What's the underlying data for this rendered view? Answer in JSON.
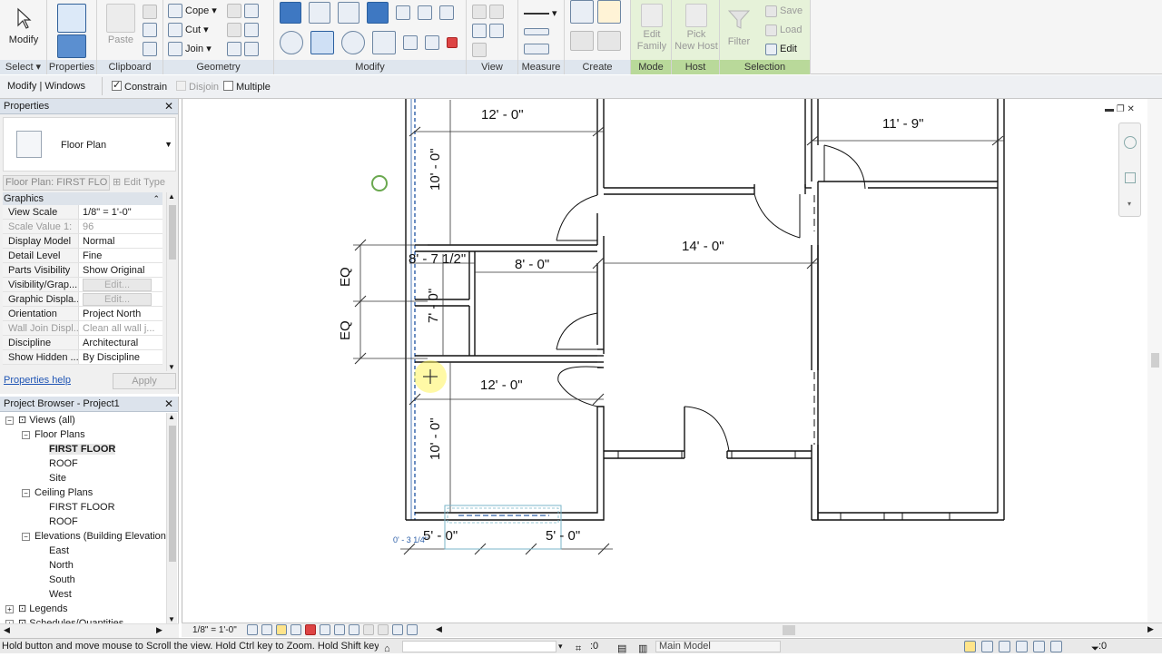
{
  "ribbon": {
    "modify_label": "Modify",
    "paste_label": "Paste",
    "cope_label": "Cope",
    "cut_label": "Cut",
    "join_label": "Join",
    "edit_family_line1": "Edit",
    "edit_family_line2": "Family",
    "pick_host_line1": "Pick",
    "pick_host_line2": "New Host",
    "filter_label": "Filter",
    "save_label": "Save",
    "load_label": "Load",
    "edit_label": "Edit",
    "panels": {
      "select": "Select",
      "properties": "Properties",
      "clipboard": "Clipboard",
      "geometry": "Geometry",
      "modify": "Modify",
      "view": "View",
      "measure": "Measure",
      "create": "Create",
      "mode": "Mode",
      "host": "Host",
      "selection": "Selection"
    }
  },
  "options_bar": {
    "context": "Modify | Windows",
    "constrain": "Constrain",
    "disjoin": "Disjoin",
    "multiple": "Multiple"
  },
  "properties": {
    "title": "Properties",
    "type_name": "Floor Plan",
    "instance_selector": "Floor Plan: FIRST FLO",
    "edit_type": "Edit Type",
    "group": "Graphics",
    "rows": [
      {
        "key": "View Scale",
        "value": "1/8\" = 1'-0\"",
        "disabled": false
      },
      {
        "key": "Scale Value    1:",
        "value": "96",
        "disabled": true
      },
      {
        "key": "Display Model",
        "value": "Normal",
        "disabled": false
      },
      {
        "key": "Detail Level",
        "value": "Fine",
        "disabled": false
      },
      {
        "key": "Parts Visibility",
        "value": "Show Original",
        "disabled": false
      },
      {
        "key": "Visibility/Grap...",
        "value": "Edit...",
        "disabled": false
      },
      {
        "key": "Graphic Displa...",
        "value": "Edit...",
        "disabled": false
      },
      {
        "key": "Orientation",
        "value": "Project North",
        "disabled": false
      },
      {
        "key": "Wall Join Displ...",
        "value": "Clean all wall j...",
        "disabled": true
      },
      {
        "key": "Discipline",
        "value": "Architectural",
        "disabled": false
      },
      {
        "key": "Show Hidden ...",
        "value": "By Discipline",
        "disabled": false
      }
    ],
    "help_link": "Properties help",
    "apply": "Apply"
  },
  "browser": {
    "title": "Project Browser - Project1",
    "items": [
      {
        "label": "Views (all)",
        "level": 0,
        "bold": false
      },
      {
        "label": "Floor Plans",
        "level": 1,
        "bold": false
      },
      {
        "label": "FIRST FLOOR",
        "level": 2,
        "bold": true
      },
      {
        "label": "ROOF",
        "level": 2,
        "bold": false
      },
      {
        "label": "Site",
        "level": 2,
        "bold": false
      },
      {
        "label": "Ceiling Plans",
        "level": 1,
        "bold": false
      },
      {
        "label": "FIRST FLOOR",
        "level": 2,
        "bold": false
      },
      {
        "label": "ROOF",
        "level": 2,
        "bold": false
      },
      {
        "label": "Elevations (Building Elevation",
        "level": 1,
        "bold": false
      },
      {
        "label": "East",
        "level": 2,
        "bold": false
      },
      {
        "label": "North",
        "level": 2,
        "bold": false
      },
      {
        "label": "South",
        "level": 2,
        "bold": false
      },
      {
        "label": "West",
        "level": 2,
        "bold": false
      },
      {
        "label": "Legends",
        "level": 0,
        "bold": false
      },
      {
        "label": "Schedules/Quantities",
        "level": 0,
        "bold": false
      }
    ]
  },
  "canvas": {
    "dims": {
      "d1": "12' - 0\"",
      "d2": "11' - 9\"",
      "d3": "10' - 0\"",
      "d4": "14' - 0\"",
      "d5": "8' - 7 1/2\"",
      "d6": "8' - 0\"",
      "d7": "EQ",
      "d8": "EQ",
      "d9": "7' - 0\"",
      "d10": "12' - 0\"",
      "d11": "10' - 0\"",
      "d12": "5' - 0\"",
      "d13": "5' - 0\"",
      "d14": "0' - 3 1/4\""
    }
  },
  "view_bar": {
    "scale": "1/8\" = 1'-0\""
  },
  "status": {
    "hint": "Hold button and move mouse to Scroll the view. Hold Ctrl key to Zoom. Hold Shift key to",
    "count": ":0",
    "model": "Main Model",
    "filter_count": ":0"
  }
}
